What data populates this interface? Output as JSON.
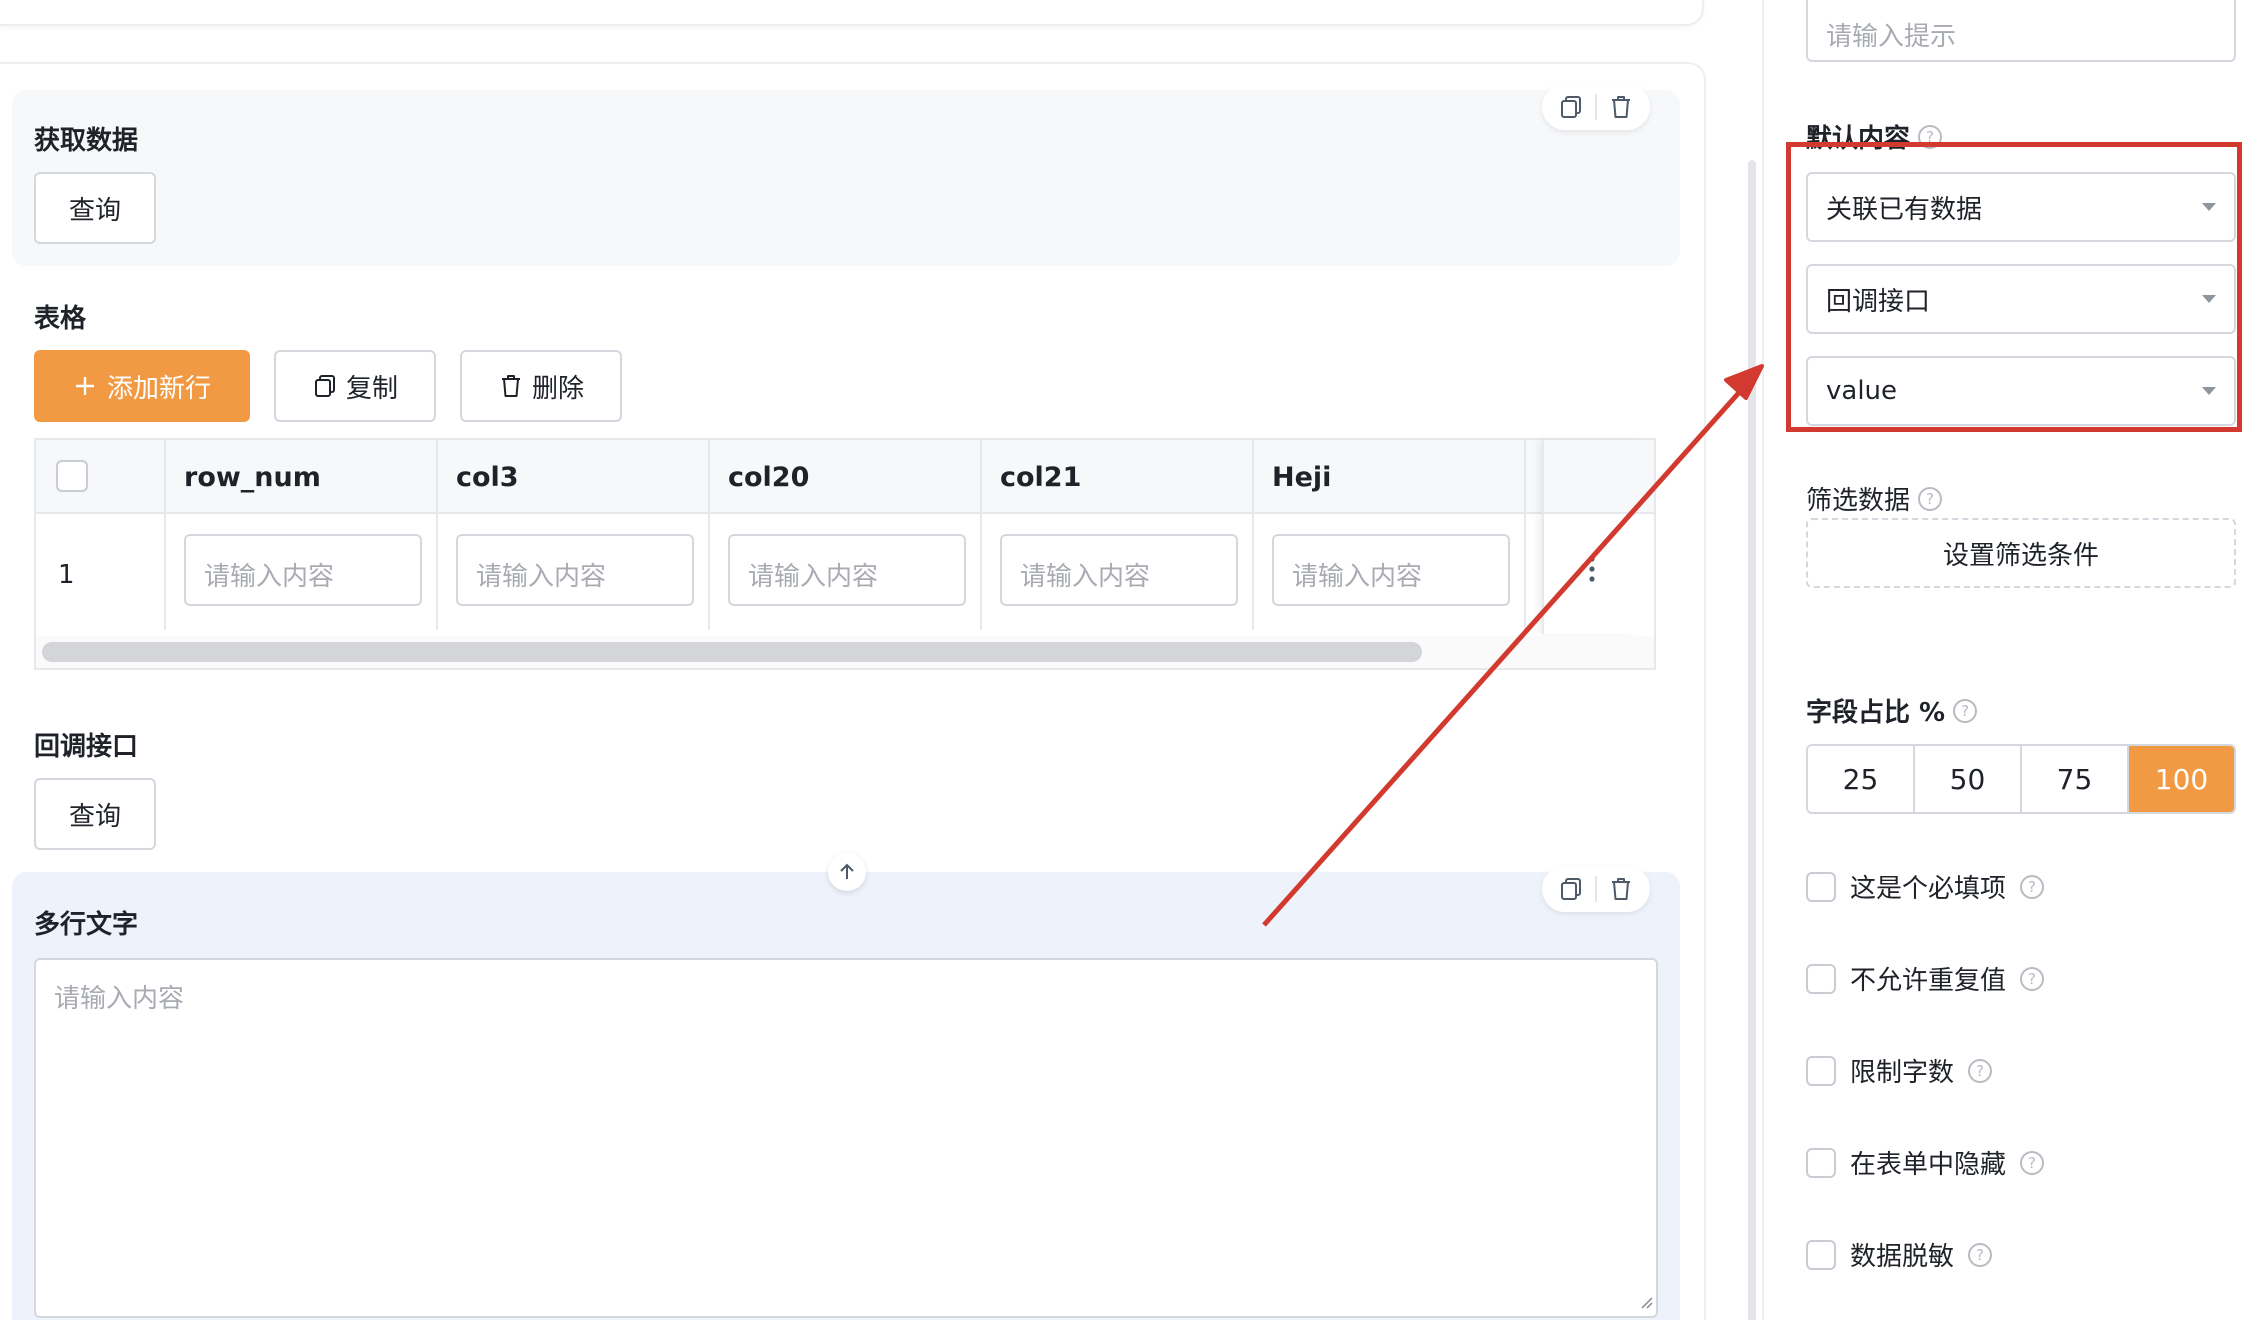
{
  "canvas": {
    "fetch_block": {
      "title": "获取数据",
      "query_button": "查询"
    },
    "table_block": {
      "title": "表格",
      "add_row_button": "添加新行",
      "copy_button": "复制",
      "delete_button": "删除",
      "columns": [
        "row_num",
        "col3",
        "col20",
        "col21",
        "Heji"
      ],
      "rows": [
        {
          "index": "1",
          "placeholders": [
            "请输入内容",
            "请输入内容",
            "请输入内容",
            "请输入内容",
            "请输入内容"
          ]
        }
      ]
    },
    "callback_block": {
      "title": "回调接口",
      "query_button": "查询"
    },
    "multiline_block": {
      "title": "多行文字",
      "placeholder": "请输入内容"
    }
  },
  "panel": {
    "hint_input_placeholder": "请输入提示",
    "default_content_label": "默认内容",
    "default_content_selects": [
      "关联已有数据",
      "回调接口",
      "value"
    ],
    "filter_label": "筛选数据",
    "filter_button": "设置筛选条件",
    "width_label": "字段占比 %",
    "width_options": [
      "25",
      "50",
      "75",
      "100"
    ],
    "width_selected": "100",
    "options": [
      "这是个必填项",
      "不允许重复值",
      "限制字数",
      "在表单中隐藏",
      "数据脱敏"
    ]
  },
  "colors": {
    "accent": "#f19a43",
    "annotation": "#d23a30"
  },
  "icons": [
    "copy-icon",
    "trash-icon",
    "plus-icon",
    "more-vertical-icon",
    "arrow-up-icon",
    "question-icon",
    "caret-down-icon"
  ]
}
